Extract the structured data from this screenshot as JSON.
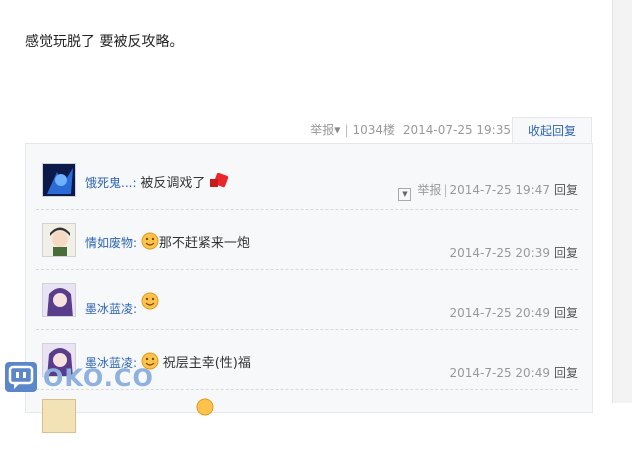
{
  "post": {
    "text": "感觉玩脱了 要被反攻略。"
  },
  "meta": {
    "report_label": "举报",
    "floor": "1034楼",
    "time": "2014-07-25 19:35",
    "collapse_label": "收起回复"
  },
  "replies": [
    {
      "user": "饿死鬼...:",
      "text": "被反调戏了",
      "has_smile": false,
      "has_dropdown": true,
      "report_label": "举报",
      "time": "2014-7-25 19:47",
      "reply_label": "回复"
    },
    {
      "user": "情如废物:",
      "text": "那不赶紧来一炮",
      "has_smile": true,
      "time": "2014-7-25 20:39",
      "reply_label": "回复"
    },
    {
      "user": "墨冰蓝凌:",
      "text": "",
      "has_smile": true,
      "time": "2014-7-25 20:49",
      "reply_label": "回复"
    },
    {
      "user": "墨冰蓝凌:",
      "text": "祝层主幸(性)福",
      "has_smile": true,
      "time": "2014-7-25 20:49",
      "reply_label": "回复"
    }
  ],
  "watermark": {
    "text": "OKO.CO"
  }
}
